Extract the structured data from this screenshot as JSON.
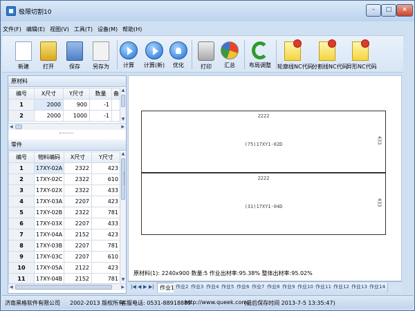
{
  "window": {
    "title": "极限切割10"
  },
  "menu": [
    "文件(F)",
    "编辑(E)",
    "视图(V)",
    "工具(T)",
    "设备(M)",
    "帮助(H)"
  ],
  "toolbar": {
    "new": "新建",
    "open": "打开",
    "save": "保存",
    "save_as": "另存为",
    "calc": "计算",
    "calc_new": "计算(新)",
    "optimize": "优化",
    "print": "打印",
    "summary": "汇总",
    "layout_adjust": "布局调整",
    "contour_nc": "轮廓线NC代码",
    "split_nc": "分割线NC代码",
    "shaped_nc": "异形NC代码"
  },
  "raw_material": {
    "header": "原材料",
    "columns": [
      "编号",
      "X尺寸",
      "Y尺寸",
      "数量",
      "备"
    ],
    "rows": [
      [
        "1",
        "2000",
        "900",
        "-1"
      ],
      [
        "2",
        "2000",
        "1000",
        "-1"
      ]
    ]
  },
  "parts": {
    "header": "零件",
    "columns": [
      "编号",
      "物料编码",
      "X尺寸",
      "Y尺寸"
    ],
    "rows": [
      [
        "1",
        "17XY-02A",
        "2322",
        "423"
      ],
      [
        "2",
        "17XY-02C",
        "2322",
        "610"
      ],
      [
        "3",
        "17XY-02X",
        "2322",
        "433"
      ],
      [
        "4",
        "17XY-03A",
        "2207",
        "423"
      ],
      [
        "5",
        "17XY-02B",
        "2322",
        "781"
      ],
      [
        "6",
        "17XY-03X",
        "2207",
        "433"
      ],
      [
        "7",
        "17XY-04A",
        "2152",
        "423"
      ],
      [
        "8",
        "17XY-03B",
        "2207",
        "781"
      ],
      [
        "9",
        "17XY-03C",
        "2207",
        "610"
      ],
      [
        "10",
        "17XY-05A",
        "2122",
        "423"
      ],
      [
        "11",
        "17XY-04B",
        "2152",
        "781"
      ]
    ]
  },
  "layout": {
    "pieces": [
      {
        "top_label": "2222",
        "center_label": "(75)17XY1-02D",
        "side_label": "433"
      },
      {
        "top_label": "2222",
        "center_label": "(31)17XY1-04D",
        "side_label": "433"
      }
    ],
    "info": "原材料(1): 2240x900  数量:5  作业出材率:95.38%  整体出材率:95.02%"
  },
  "sheet_tabs": {
    "nav": [
      "|◀",
      "◀",
      "▶",
      "▶|"
    ],
    "tabs": [
      "作业1",
      "作业2",
      "作业3",
      "作业4",
      "作业5",
      "作业6",
      "作业7",
      "作业8",
      "作业9",
      "作业10",
      "作业11",
      "作业12",
      "作业13",
      "作业14"
    ],
    "active": 0
  },
  "statusbar": {
    "company": "济南黑格软件有限公司",
    "copyright": "2002-2013 版权所有",
    "phone": "客服电话: 0531-88918889",
    "url": "http://www.queek.com",
    "saved": "(最后保存时间 2013-7-5 13:35:47)"
  }
}
